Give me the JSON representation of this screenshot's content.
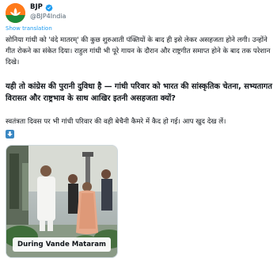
{
  "account": {
    "name": "BJP",
    "handle": "@BJP4India",
    "verified_color": "#1d9bf0",
    "avatar_icon": "bjp-lotus-logo"
  },
  "translate_label": "Show translation",
  "tweet": {
    "p1": "सोनिया गांधी को 'वंदे मातरम्' की कुछ शुरुआती पंक्तियों के बाद ही इसे लेकर असहजता होने लगी। उन्होंने गीत रोकने का संकेत दिया। राहुल गांधी भी पूरे गायन के दौरान और राष्ट्रगीत समाप्त होने के बाद तक परेशान दिखे।",
    "p2": "यही तो कांग्रेस की पुरानी दुविधा है — गांधी परिवार को भारत की सांस्कृतिक चेतना, सभ्यतागत विरासत और राष्ट्रभाव के साथ आखिर इतनी असहजता क्यों?",
    "p3": "स्वतंत्रता दिवस पर भी गांधी परिवार की वही बेचैनी कैमरे में कैद हो गई। आप खुद देख लें।",
    "emoji": "down-arrow-icon"
  },
  "media": {
    "caption": "During Vande Mataram"
  }
}
